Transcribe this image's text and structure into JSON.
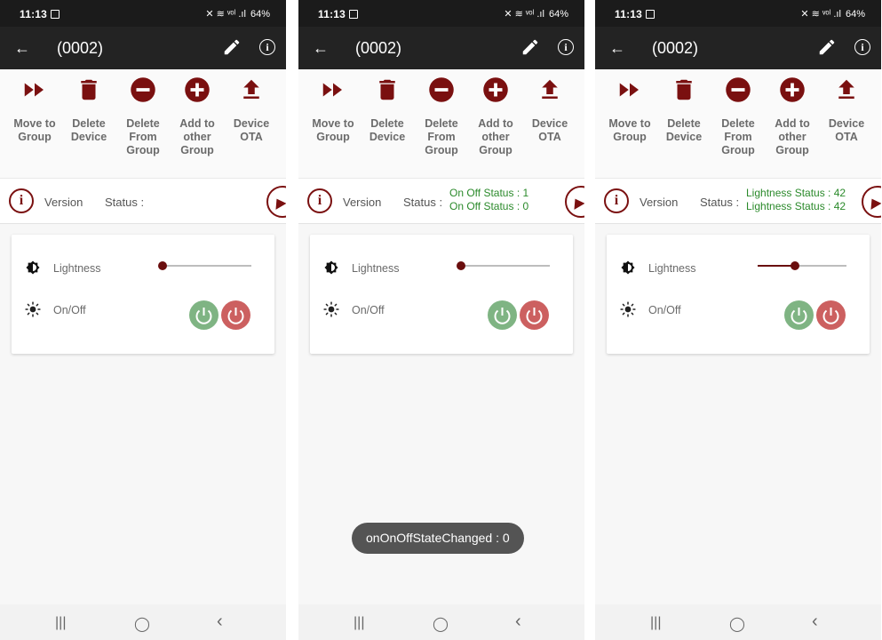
{
  "screens": [
    {
      "status_bar": {
        "time": "11:13",
        "sys_icons": "✕ ≋ ᵛᵒˡ .ıl",
        "battery": "64%"
      },
      "app_bar": {
        "back": "←",
        "title": "(0002)"
      },
      "actions": [
        {
          "label": "Move to Group",
          "icon": "fast-forward-icon"
        },
        {
          "label": "Delete Device",
          "icon": "trash-icon"
        },
        {
          "label": "Delete From Group",
          "icon": "minus-circle-icon"
        },
        {
          "label": "Add to other Group",
          "icon": "plus-circle-icon"
        },
        {
          "label": "Device OTA",
          "icon": "upload-icon"
        }
      ],
      "info_row": {
        "version_label": "Version",
        "status_label": "Status :",
        "status_lines": [
          "",
          ""
        ]
      },
      "controls": {
        "lightness_label": "Lightness",
        "onoff_label": "On/Off",
        "lightness_level": 0.0
      },
      "toast": "",
      "nav": {
        "recents": "|||",
        "home": "◯",
        "back": "‹"
      }
    },
    {
      "status_bar": {
        "time": "11:13",
        "sys_icons": "✕ ≋ ᵛᵒˡ .ıl",
        "battery": "64%"
      },
      "app_bar": {
        "back": "←",
        "title": "(0002)"
      },
      "actions": [
        {
          "label": "Move to Group",
          "icon": "fast-forward-icon"
        },
        {
          "label": "Delete Device",
          "icon": "trash-icon"
        },
        {
          "label": "Delete From Group",
          "icon": "minus-circle-icon"
        },
        {
          "label": "Add to other Group",
          "icon": "plus-circle-icon"
        },
        {
          "label": "Device OTA",
          "icon": "upload-icon"
        }
      ],
      "info_row": {
        "version_label": "Version",
        "status_label": "Status :",
        "status_lines": [
          "On Off Status : 1",
          "On Off Status : 0"
        ]
      },
      "controls": {
        "lightness_label": "Lightness",
        "onoff_label": "On/Off",
        "lightness_level": 0.0
      },
      "toast": "onOnOffStateChanged : 0",
      "nav": {
        "recents": "|||",
        "home": "◯",
        "back": "‹"
      }
    },
    {
      "status_bar": {
        "time": "11:13",
        "sys_icons": "✕ ≋ ᵛᵒˡ .ıl",
        "battery": "64%"
      },
      "app_bar": {
        "back": "←",
        "title": "(0002)"
      },
      "actions": [
        {
          "label": "Move to Group",
          "icon": "fast-forward-icon"
        },
        {
          "label": "Delete Device",
          "icon": "trash-icon"
        },
        {
          "label": "Delete From Group",
          "icon": "minus-circle-icon"
        },
        {
          "label": "Add to other Group",
          "icon": "plus-circle-icon"
        },
        {
          "label": "Device OTA",
          "icon": "upload-icon"
        }
      ],
      "info_row": {
        "version_label": "Version",
        "status_label": "Status :",
        "status_lines": [
          "Lightness Status : 42",
          "Lightness Status : 42"
        ]
      },
      "controls": {
        "lightness_label": "Lightness",
        "onoff_label": "On/Off",
        "lightness_level": 0.42
      },
      "toast": "",
      "nav": {
        "recents": "|||",
        "home": "◯",
        "back": "‹"
      }
    }
  ],
  "colors": {
    "accent": "#7a1010",
    "status_green": "#2b8a2b",
    "power_on": "#7fb483",
    "power_off": "#cc6060",
    "appbar": "#232323"
  }
}
